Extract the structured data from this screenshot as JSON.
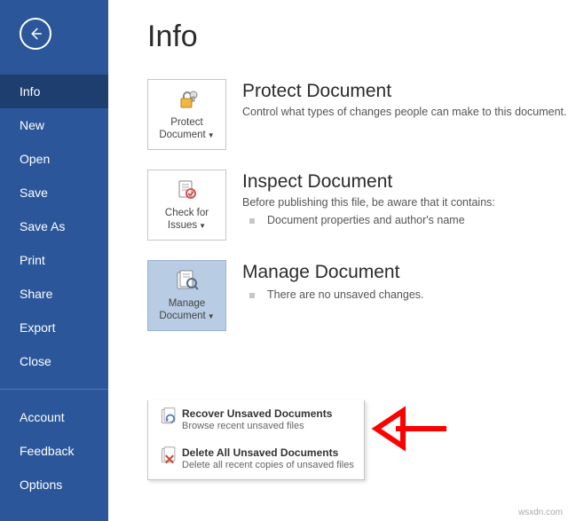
{
  "sidebar": {
    "items": [
      {
        "label": "Info",
        "active": true
      },
      {
        "label": "New"
      },
      {
        "label": "Open"
      },
      {
        "label": "Save"
      },
      {
        "label": "Save As"
      },
      {
        "label": "Print"
      },
      {
        "label": "Share"
      },
      {
        "label": "Export"
      },
      {
        "label": "Close"
      }
    ],
    "footer_items": [
      {
        "label": "Account"
      },
      {
        "label": "Feedback"
      },
      {
        "label": "Options"
      }
    ]
  },
  "page_title": "Info",
  "protect": {
    "tile_line1": "Protect",
    "tile_line2": "Document",
    "title": "Protect Document",
    "desc": "Control what types of changes people can make to this document."
  },
  "inspect": {
    "tile_line1": "Check for",
    "tile_line2": "Issues",
    "title": "Inspect Document",
    "desc": "Before publishing this file, be aware that it contains:",
    "bullet": "Document properties and author's name"
  },
  "manage": {
    "tile_line1": "Manage",
    "tile_line2": "Document",
    "title": "Manage Document",
    "desc": "There are no unsaved changes."
  },
  "dropdown": {
    "recover": {
      "title": "Recover Unsaved Documents",
      "desc": "Browse recent unsaved files"
    },
    "delete": {
      "title": "Delete All Unsaved Documents",
      "desc": "Delete all recent copies of unsaved files"
    }
  },
  "watermark": "wsxdn.com"
}
